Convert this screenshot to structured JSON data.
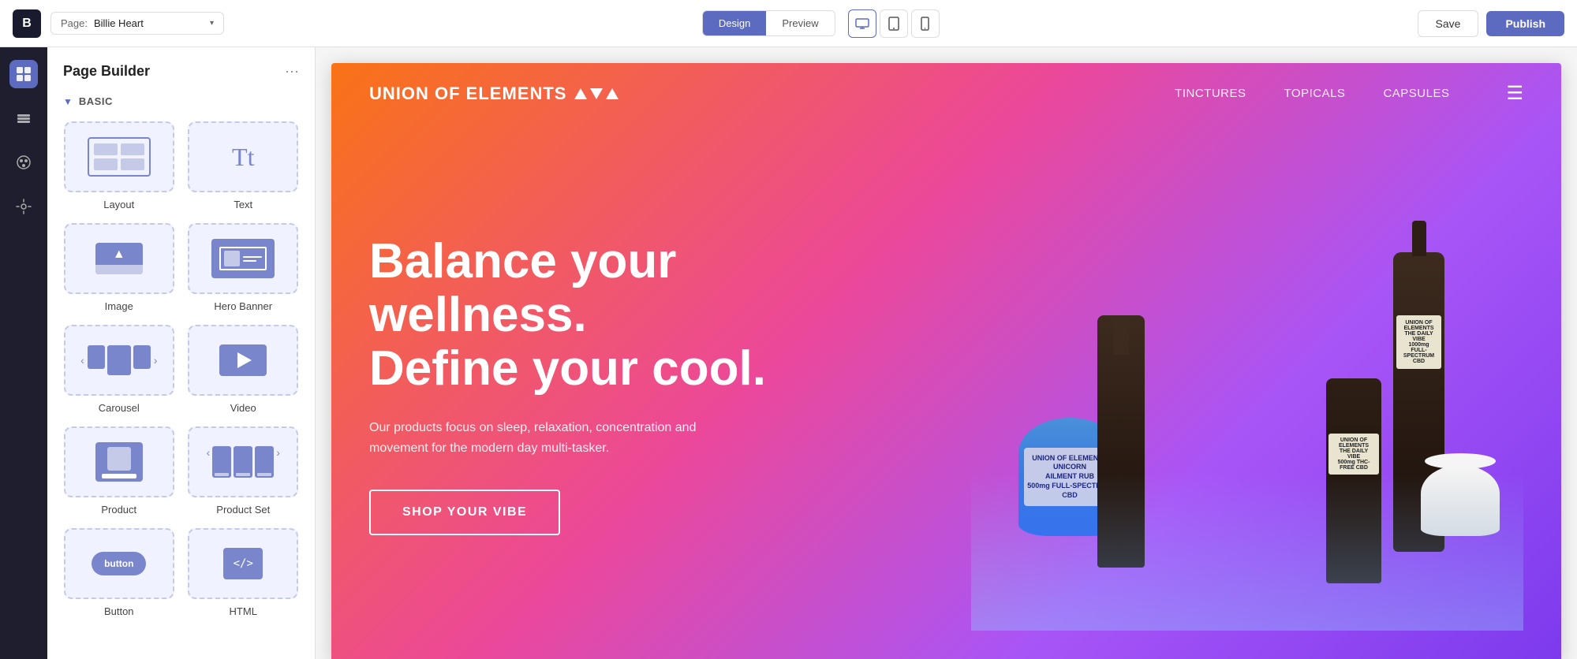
{
  "topbar": {
    "logo_text": "B",
    "page_label": "Page:",
    "page_value": "Billie Heart",
    "design_label": "Design",
    "preview_label": "Preview",
    "save_label": "Save",
    "publish_label": "Publish"
  },
  "view_icons": {
    "desktop_title": "Desktop",
    "tablet_title": "Tablet",
    "mobile_title": "Mobile"
  },
  "sidebar": {
    "title": "Page Builder",
    "section_label": "BASIC",
    "widgets": [
      {
        "id": "layout",
        "label": "Layout"
      },
      {
        "id": "text",
        "label": "Text"
      },
      {
        "id": "image",
        "label": "Image"
      },
      {
        "id": "hero-banner",
        "label": "Hero Banner"
      },
      {
        "id": "carousel",
        "label": "Carousel"
      },
      {
        "id": "video",
        "label": "Video"
      },
      {
        "id": "product",
        "label": "Product"
      },
      {
        "id": "product-set",
        "label": "Product Set"
      },
      {
        "id": "button",
        "label": "Button"
      },
      {
        "id": "html",
        "label": "HTML"
      }
    ]
  },
  "hero": {
    "logo_text": "UNION OF ELEMENTS",
    "nav_links": [
      "TINCTURES",
      "TOPICALS",
      "CAPSULES"
    ],
    "heading_line1": "Balance your wellness.",
    "heading_line2": "Define your cool.",
    "subtext": "Our products focus on sleep, relaxation, concentration and movement for the modern day multi-tasker.",
    "cta_label": "SHOP YOUR VIBE"
  }
}
